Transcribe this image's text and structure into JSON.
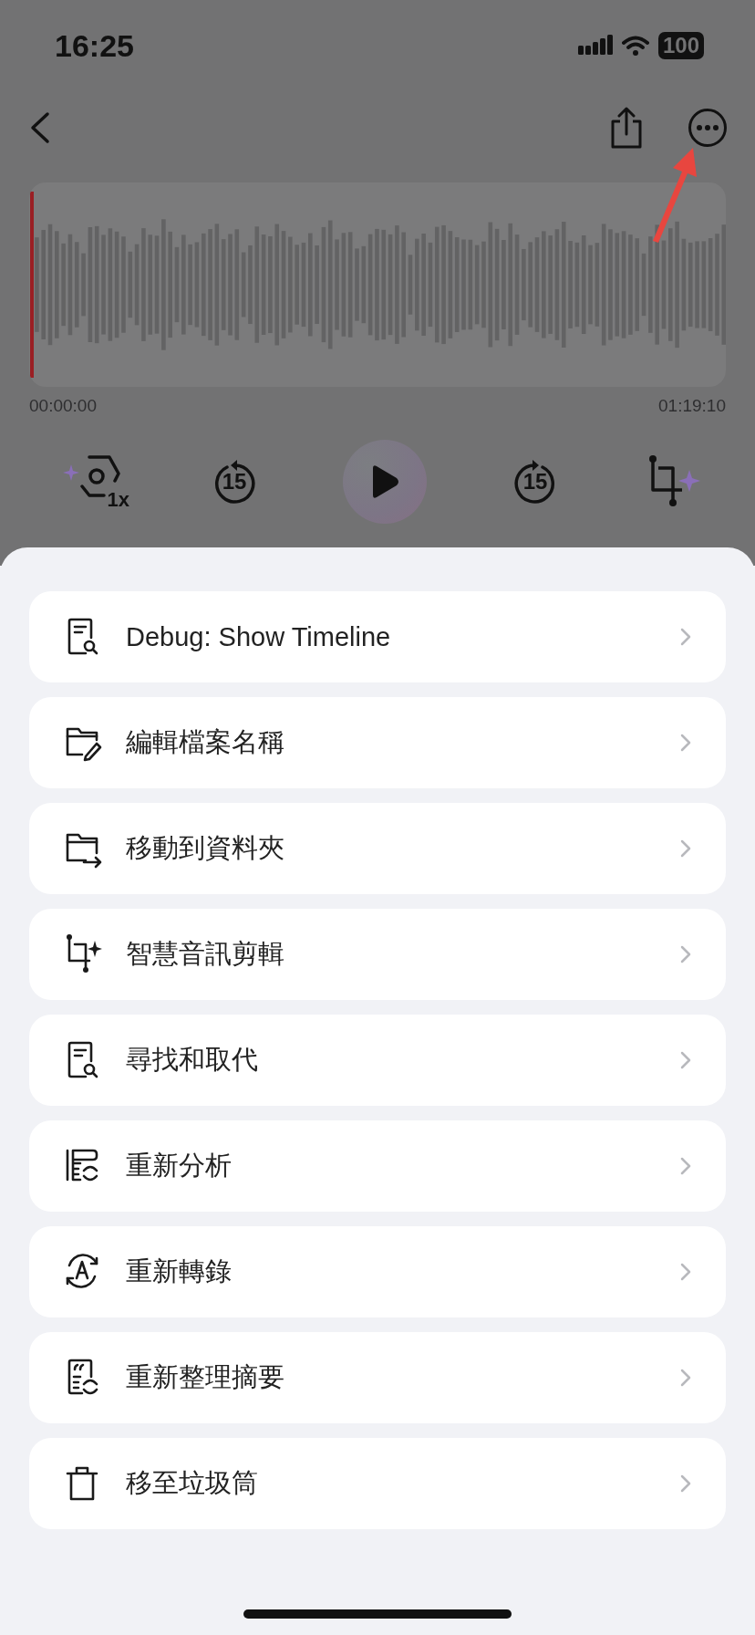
{
  "status_bar": {
    "time": "16:25",
    "battery": "100"
  },
  "waveform": {
    "start_time": "00:00:00",
    "end_time": "01:19:10"
  },
  "playback_controls": {
    "speed": "1x",
    "skip_back": "15",
    "skip_forward": "15"
  },
  "menu": {
    "items": [
      {
        "kind": "doc-search",
        "label": "Debug: Show Timeline"
      },
      {
        "kind": "folder-edit",
        "label": "編輯檔案名稱"
      },
      {
        "kind": "folder-move",
        "label": "移動到資料夾"
      },
      {
        "kind": "smart-crop",
        "label": "智慧音訊剪輯"
      },
      {
        "kind": "doc-search",
        "label": "尋找和取代"
      },
      {
        "kind": "reanalyze",
        "label": "重新分析"
      },
      {
        "kind": "retranscribe",
        "label": "重新轉錄"
      },
      {
        "kind": "resummarize",
        "label": "重新整理摘要"
      },
      {
        "kind": "trash",
        "label": "移至垃圾筒"
      }
    ]
  }
}
